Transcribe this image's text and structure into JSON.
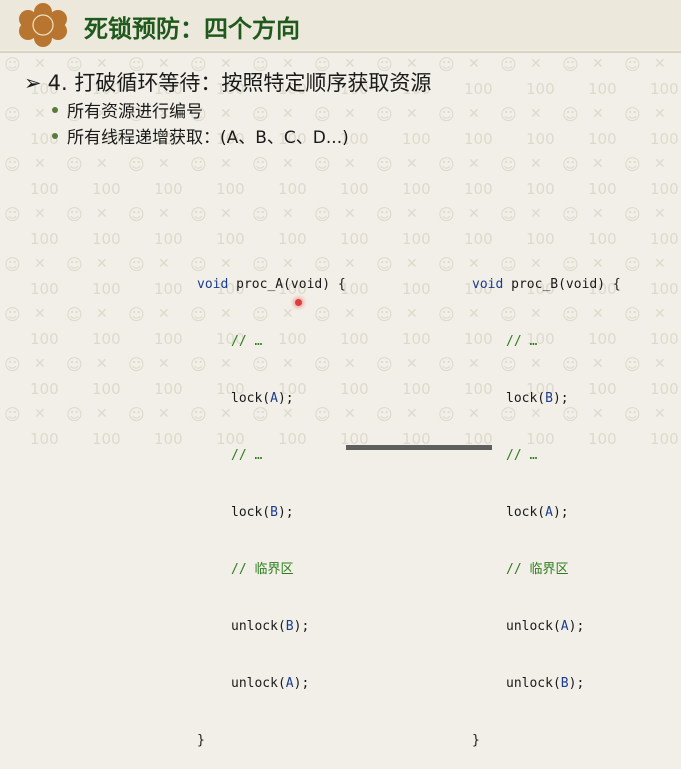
{
  "slide": {
    "title": "死锁预防：四个方向",
    "main_point": "4. 打破循环等待：按照特定顺序获取资源",
    "sub_points": [
      "所有资源进行编号",
      "所有线程递增获取：(A、B、C、D...)"
    ]
  },
  "code_a": {
    "signature_kw": "void",
    "signature_rest": " proc_A(void) {",
    "body": [
      {
        "type": "comment",
        "text": "// …"
      },
      {
        "type": "call",
        "fn": "lock(",
        "arg": "A",
        "end": ");"
      },
      {
        "type": "comment",
        "text": "// …"
      },
      {
        "type": "call",
        "fn": "lock(",
        "arg": "B",
        "end": ");"
      },
      {
        "type": "comment",
        "text": "// 临界区"
      },
      {
        "type": "call",
        "fn": "unlock(",
        "arg": "B",
        "end": ");"
      },
      {
        "type": "call",
        "fn": "unlock(",
        "arg": "A",
        "end": ");"
      }
    ],
    "closing": "}"
  },
  "code_b": {
    "signature_kw": "void",
    "signature_rest": " proc_B(void) {",
    "body": [
      {
        "type": "comment",
        "text": "// …"
      },
      {
        "type": "call",
        "fn": "lock(",
        "arg": "B",
        "end": ");"
      },
      {
        "type": "comment",
        "text": "// …"
      },
      {
        "type": "call",
        "fn": "lock(",
        "arg": "A",
        "end": ");"
      },
      {
        "type": "comment",
        "text": "// 临界区"
      },
      {
        "type": "call",
        "fn": "unlock(",
        "arg": "A",
        "end": ");"
      },
      {
        "type": "call",
        "fn": "unlock(",
        "arg": "B",
        "end": ");"
      }
    ],
    "closing": "}"
  },
  "colors": {
    "title": "#1f5a1c",
    "logo": "#b8752f",
    "keyword": "#1a3d8f",
    "comment": "#2e7d1e",
    "pointer": "#e23b3b"
  }
}
